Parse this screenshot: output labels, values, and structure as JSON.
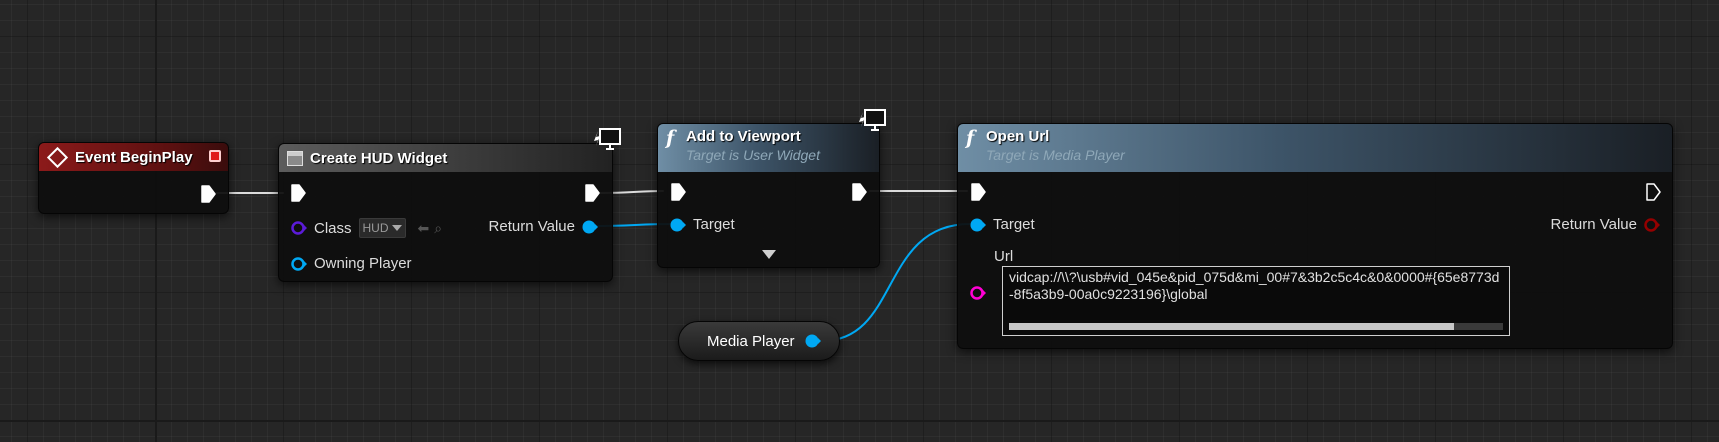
{
  "colors": {
    "event_header": "#8c1a1a",
    "object_pin": "#00a8f3",
    "class_pin": "#5b1bd8",
    "string_pin": "#ff00d4",
    "bool_pin": "#950000",
    "exec_pin": "#ffffff",
    "stop_button": "#e01b1b"
  },
  "nodes": {
    "event_begin_play": {
      "title": "Event BeginPlay",
      "icon": "event-diamond-icon",
      "stop_icon": "stop-square-icon"
    },
    "create_hud_widget": {
      "title": "Create HUD Widget",
      "icon": "widget-icon",
      "network_icon": "monitor-icon",
      "class_label": "Class",
      "class_value": "HUD",
      "owning_player_label": "Owning Player",
      "return_value_label": "Return Value"
    },
    "add_to_viewport": {
      "title": "Add to Viewport",
      "subtitle": "Target is User Widget",
      "icon": "function-icon",
      "network_icon": "monitor-icon",
      "target_label": "Target"
    },
    "open_url": {
      "title": "Open Url",
      "subtitle": "Target is Media Player",
      "icon": "function-icon",
      "target_label": "Target",
      "return_value_label": "Return Value",
      "url_label": "Url",
      "url_value": "vidcap://\\\\?\\usb#vid_045e&pid_075d&mi_00#7&3b2c5c4c&0&0000#{65e8773d-8f5a3b9-00a0c9223196}\\global",
      "url_scroll_fraction": 0.9
    },
    "media_player_var": {
      "label": "Media Player"
    }
  }
}
